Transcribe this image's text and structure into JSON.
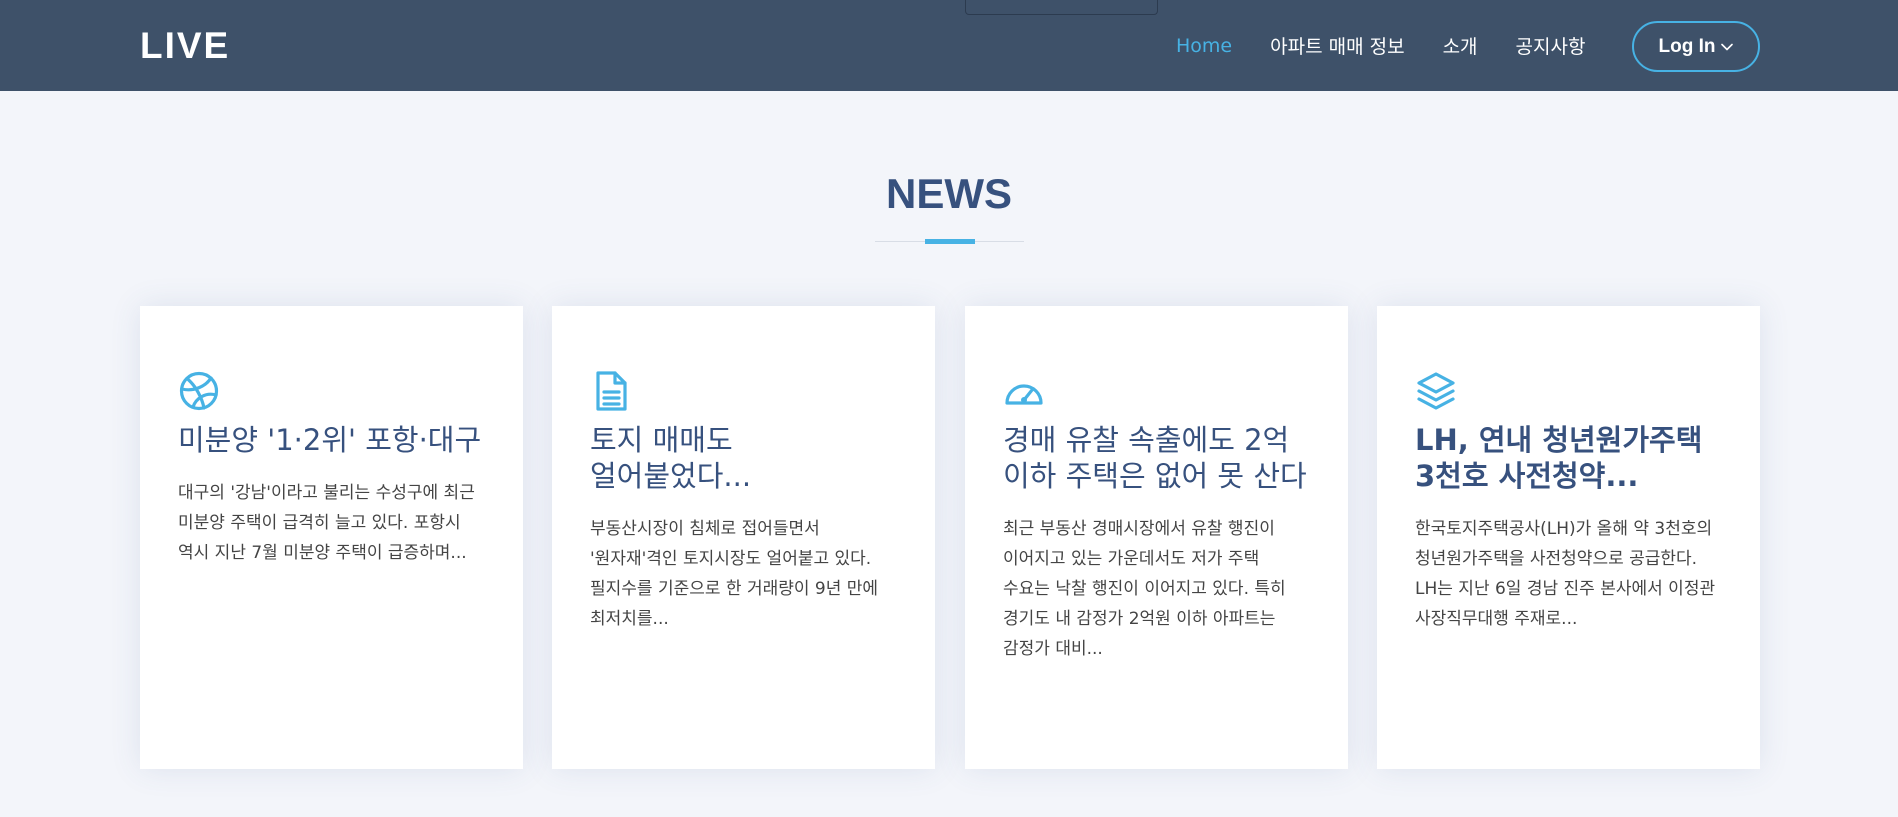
{
  "header": {
    "logo": "LIVE",
    "nav": [
      {
        "label": "Home",
        "active": true
      },
      {
        "label": "아파트 매매 정보",
        "active": false
      },
      {
        "label": "소개",
        "active": false
      },
      {
        "label": "공지사항",
        "active": false
      }
    ],
    "login_label": "Log In"
  },
  "section": {
    "title": "NEWS"
  },
  "cards": [
    {
      "icon": "dribbble-icon",
      "title": "미분양 '1·2위' 포항·대구",
      "description": "대구의 '강남'이라고 불리는 수성구에 최근 미분양 주택이 급격히 늘고 있다. 포항시 역시 지난 7월 미분양 주택이 급증하며..."
    },
    {
      "icon": "file-text-icon",
      "title": "토지 매매도 얼어붙었다...",
      "description": "부동산시장이 침체로 접어들면서 '원자재'격인 토지시장도 얼어붙고 있다. 필지수를 기준으로 한 거래량이 9년 만에 최저치를..."
    },
    {
      "icon": "speedometer-icon",
      "title": "경매 유찰 속출에도 2억 이하 주택은 없어 못 산다",
      "description": "최근 부동산 경매시장에서 유찰 행진이 이어지고 있는 가운데서도 저가 주택 수요는 낙찰 행진이 이어지고 있다. 특히 경기도 내 감정가 2억원 이하 아파트는 감정가 대비..."
    },
    {
      "icon": "layers-icon",
      "title": "LH, 연내 청년원가주택 3천호 사전청약...",
      "description": "한국토지주택공사(LH)가 올해 약 3천호의 청년원가주택을 사전청약으로 공급한다. LH는 지난 6일 경남 진주 본사에서 이정관 사장직무대행 주재로..."
    }
  ],
  "colors": {
    "header_bg": "#3e5169",
    "accent": "#47b2e4",
    "title": "#37517e",
    "page_bg": "#f3f5fa"
  }
}
